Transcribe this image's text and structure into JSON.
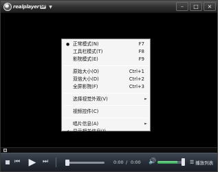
{
  "titlebar": {
    "logo_text": "realplayer",
    "logo_badge": "SP",
    "buttons": {
      "minimize": "–",
      "maximize": "□",
      "close": "×"
    }
  },
  "context_menu": {
    "items": [
      {
        "label": "正常模式(N)",
        "shortcut": "F7",
        "mark": "●"
      },
      {
        "label": "工具栏模式(T)",
        "shortcut": "F8"
      },
      {
        "label": "影院模式(E)",
        "shortcut": "F9"
      },
      {
        "label": "原始大小(O)",
        "shortcut": "Ctrl+1"
      },
      {
        "label": "双倍大小(D)",
        "shortcut": "Ctrl+2"
      },
      {
        "label": "全屏影院(F)",
        "shortcut": "Ctrl+3"
      },
      {
        "label": "选择视觉外观(V)",
        "submenu": "►"
      },
      {
        "label": "视频控件(C)"
      },
      {
        "label": "唱片信息(A)",
        "submenu": "►"
      },
      {
        "label": "显示相关信息(I)",
        "mark": "✔"
      }
    ]
  },
  "controls": {
    "time_current": "0:00",
    "time_separator": "/",
    "time_total": "0:00",
    "playlist_label": "播放列表",
    "volume_level": 0.8,
    "progress_level": 0
  },
  "icons": {
    "stop": "stop-icon",
    "prev": "prev-icon",
    "play": "play-icon",
    "next": "next-icon",
    "volume": "volume-icon",
    "playlist": "playlist-icon"
  }
}
